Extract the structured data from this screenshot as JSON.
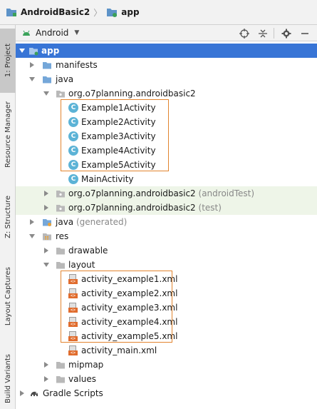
{
  "breadcrumb": {
    "project": "AndroidBasic2",
    "module": "app"
  },
  "toolstrip": {
    "tabs": [
      {
        "label": "1: Project"
      },
      {
        "label": "Resource Manager"
      },
      {
        "label": "Z: Structure"
      },
      {
        "label": "Layout Captures"
      },
      {
        "label": "Build Variants"
      }
    ]
  },
  "panel": {
    "view_mode": "Android"
  },
  "tree": {
    "app": "app",
    "manifests": "manifests",
    "java": "java",
    "package_main": "org.o7planning.androidbasic2",
    "classes": [
      "Example1Activity",
      "Example2Activity",
      "Example3Activity",
      "Example4Activity",
      "Example5Activity",
      "MainActivity"
    ],
    "package_android_test": "org.o7planning.androidbasic2",
    "package_android_test_suffix": "(androidTest)",
    "package_test": "org.o7planning.androidbasic2",
    "package_test_suffix": "(test)",
    "java_generated": "java",
    "java_generated_suffix": "(generated)",
    "res": "res",
    "drawable": "drawable",
    "layout": "layout",
    "layout_files": [
      "activity_example1.xml",
      "activity_example2.xml",
      "activity_example3.xml",
      "activity_example4.xml",
      "activity_example5.xml",
      "activity_main.xml"
    ],
    "mipmap": "mipmap",
    "values": "values",
    "gradle_scripts": "Gradle Scripts"
  },
  "colors": {
    "selection": "#3875d6",
    "highlight_box": "#e2852f",
    "folder_blue": "#75a7d9",
    "class_icon": "#5cb3d6",
    "xml_tag": "#e06c2d"
  }
}
